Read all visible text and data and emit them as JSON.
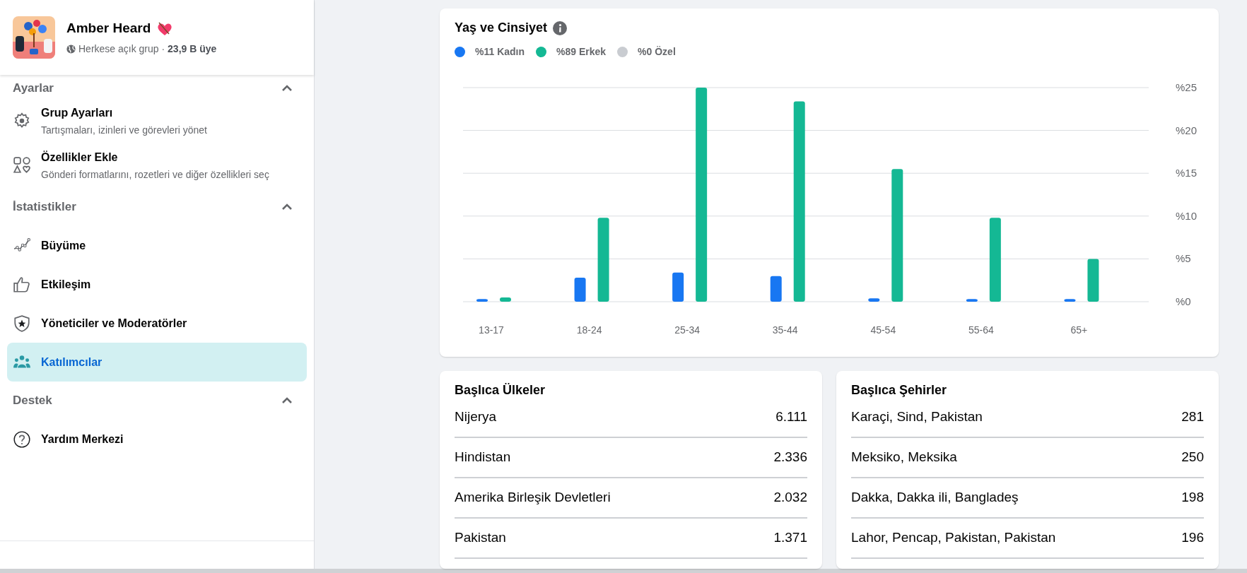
{
  "group": {
    "name": "Amber Heard",
    "meta": "Herkese açık grup · **23,9 B üye**"
  },
  "sidebar": {
    "sections": [
      {
        "title": "Ayarlar",
        "expanded": true,
        "items": [
          {
            "kind": "gear",
            "label": "Grup Ayarları",
            "description": "Tartışmaları, izinleri ve görevleri yönet",
            "selected": false
          },
          {
            "kind": "shapes",
            "label": "Özellikler Ekle",
            "description": "Gönderi formatlarını, rozetleri ve diğer özellikleri seç",
            "selected": false
          }
        ]
      },
      {
        "title": "İstatistikler",
        "expanded": true,
        "items": [
          {
            "kind": "growth",
            "label": "Büyüme",
            "selected": false
          },
          {
            "kind": "like",
            "label": "Etkileşim",
            "selected": false
          },
          {
            "kind": "shield",
            "label": "Yöneticiler ve Moderatörler",
            "selected": false
          },
          {
            "kind": "people",
            "label": "Katılımcılar",
            "selected": true
          }
        ]
      },
      {
        "title": "Destek",
        "expanded": true,
        "items": [
          {
            "kind": "help",
            "label": "Yardım Merkezi",
            "selected": false
          }
        ]
      }
    ]
  },
  "age_gender": {
    "title": "Yaş ve Cinsiyet",
    "legend": [
      {
        "label": "%11 Kadın",
        "color": "#1877f2"
      },
      {
        "label": "%89 Erkek",
        "color": "#14b894"
      },
      {
        "label": "%0 Özel",
        "color": "#c9ccd1"
      }
    ],
    "chart_data": {
      "type": "bar",
      "grid": true,
      "categories": [
        "13-17",
        "18-24",
        "25-34",
        "35-44",
        "45-54",
        "55-64",
        "65+"
      ],
      "series": [
        {
          "color": "#1877f2",
          "values": [
            0.3,
            2.8,
            3.4,
            3.0,
            0.4,
            0.3,
            0.3
          ]
        },
        {
          "color": "#14b894",
          "values": [
            0.5,
            9.8,
            25.0,
            23.4,
            15.5,
            9.8,
            5.0
          ]
        }
      ],
      "ylim": [
        0,
        25
      ],
      "yticks": [
        {
          "value": 0,
          "label": "%0"
        },
        {
          "value": 5,
          "label": "%5"
        },
        {
          "value": 10,
          "label": "%10"
        },
        {
          "value": 15,
          "label": "%15"
        },
        {
          "value": 20,
          "label": "%20"
        },
        {
          "value": 25,
          "label": "%25"
        }
      ]
    }
  },
  "top_countries": {
    "title": "Başlıca Ülkeler",
    "rows": [
      {
        "name": "Nijerya",
        "count": "6.111"
      },
      {
        "name": "Hindistan",
        "count": "2.336"
      },
      {
        "name": "Amerika Birleşik Devletleri",
        "count": "2.032"
      },
      {
        "name": "Pakistan",
        "count": "1.371"
      }
    ]
  },
  "top_cities": {
    "title": "Başlıca Şehirler",
    "rows": [
      {
        "name": "Karaçi, Sind, Pakistan",
        "count": "281"
      },
      {
        "name": "Meksiko, Meksika",
        "count": "250"
      },
      {
        "name": "Dakka, Dakka ili, Bangladeş",
        "count": "198"
      },
      {
        "name": "Lahor, Pencap, Pakistan, Pakistan",
        "count": "196"
      }
    ]
  }
}
